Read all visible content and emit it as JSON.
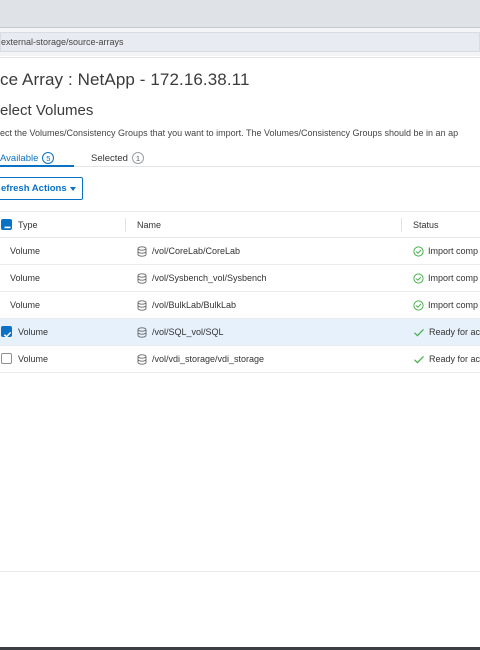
{
  "browser": {
    "url": "external-storage/source-arrays"
  },
  "page": {
    "title": "ce Array : NetApp - 172.16.38.11",
    "section_title": "elect Volumes",
    "description": "ect the Volumes/Consistency Groups that you want to import. The Volumes/Consistency Groups should be in an ap"
  },
  "tabs": [
    {
      "label": "Available",
      "count": "5"
    },
    {
      "label": "Selected",
      "count": "1"
    }
  ],
  "toolbar": {
    "refresh_label": "efresh Actions"
  },
  "table": {
    "columns": [
      "Type",
      "Name",
      "Status"
    ],
    "rows": [
      {
        "type": "Volume",
        "name": "/vol/CoreLab/CoreLab",
        "status": "Import comp"
      },
      {
        "type": "Volume",
        "name": "/vol/Sysbench_vol/Sysbench",
        "status": "Import comp"
      },
      {
        "type": "Volume",
        "name": "/vol/BulkLab/BulkLab",
        "status": "Import comp"
      },
      {
        "type": "Volume",
        "name": "/vol/SQL_vol/SQL",
        "status": "Ready for ac"
      },
      {
        "type": "Volume",
        "name": "/vol/vdi_storage/vdi_storage",
        "status": "Ready for ac"
      }
    ]
  },
  "colors": {
    "accent": "#0a72c5",
    "success": "#4caf50",
    "selected_row": "#e7f1fb"
  },
  "icons": [
    "database-icon",
    "check-circle-icon",
    "checkmark-icon",
    "caret-down-icon"
  ]
}
